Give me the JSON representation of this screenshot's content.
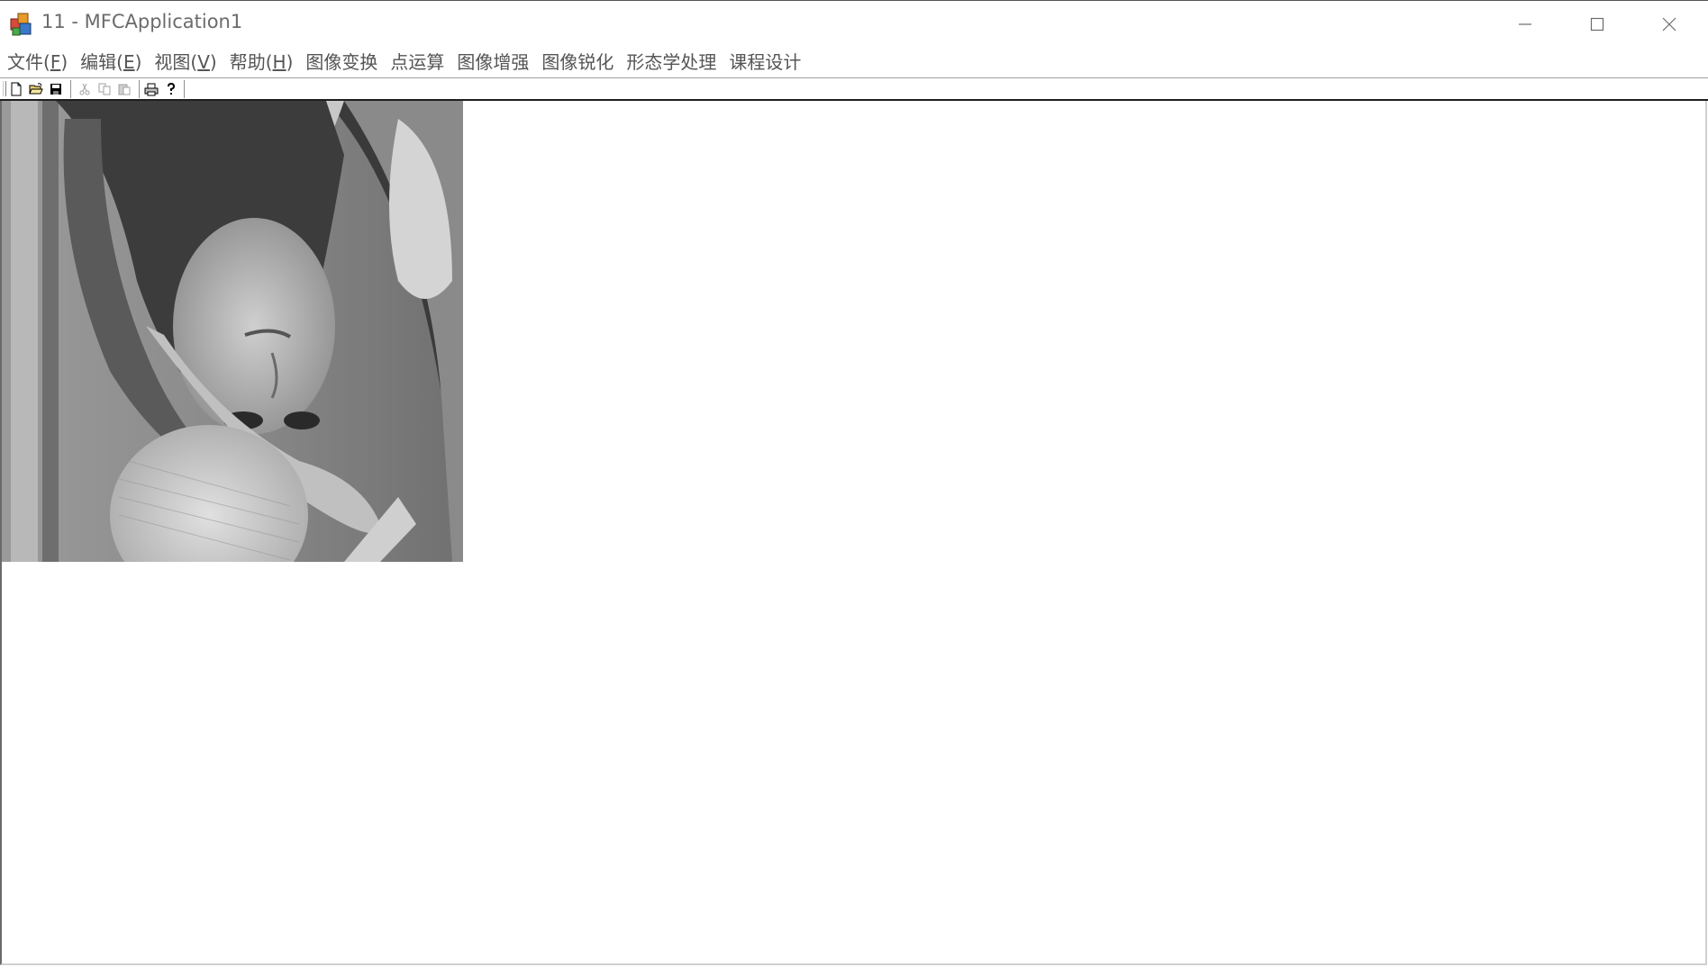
{
  "window": {
    "title": "11 - MFCApplication1"
  },
  "menu": {
    "items": [
      {
        "label": "文件(",
        "accel": "F",
        "tail": ")"
      },
      {
        "label": "编辑(",
        "accel": "E",
        "tail": ")"
      },
      {
        "label": "视图(",
        "accel": "V",
        "tail": ")"
      },
      {
        "label": "帮助(",
        "accel": "H",
        "tail": ")"
      },
      {
        "label": "图像变换",
        "accel": "",
        "tail": ""
      },
      {
        "label": "点运算",
        "accel": "",
        "tail": ""
      },
      {
        "label": "图像增强",
        "accel": "",
        "tail": ""
      },
      {
        "label": "图像锐化",
        "accel": "",
        "tail": ""
      },
      {
        "label": "形态学处理",
        "accel": "",
        "tail": ""
      },
      {
        "label": "课程设计",
        "accel": "",
        "tail": ""
      }
    ]
  },
  "toolbar": {
    "buttons": [
      {
        "name": "new-file-icon",
        "enabled": true
      },
      {
        "name": "open-folder-icon",
        "enabled": true
      },
      {
        "name": "save-disk-icon",
        "enabled": true
      },
      {
        "name": "cut-icon",
        "enabled": false
      },
      {
        "name": "copy-icon",
        "enabled": false
      },
      {
        "name": "paste-icon",
        "enabled": false
      },
      {
        "name": "print-icon",
        "enabled": true
      },
      {
        "name": "help-icon",
        "enabled": true
      }
    ]
  },
  "image": {
    "description_icon": "grayscale-photo-rotated-180",
    "palette": {
      "dark": "#2a2a2a",
      "mid": "#8a8a8a",
      "light": "#d8d8d8"
    }
  },
  "colors": {
    "title_text": "#6b6b6b",
    "menu_text": "#555555",
    "background": "#ffffff"
  }
}
